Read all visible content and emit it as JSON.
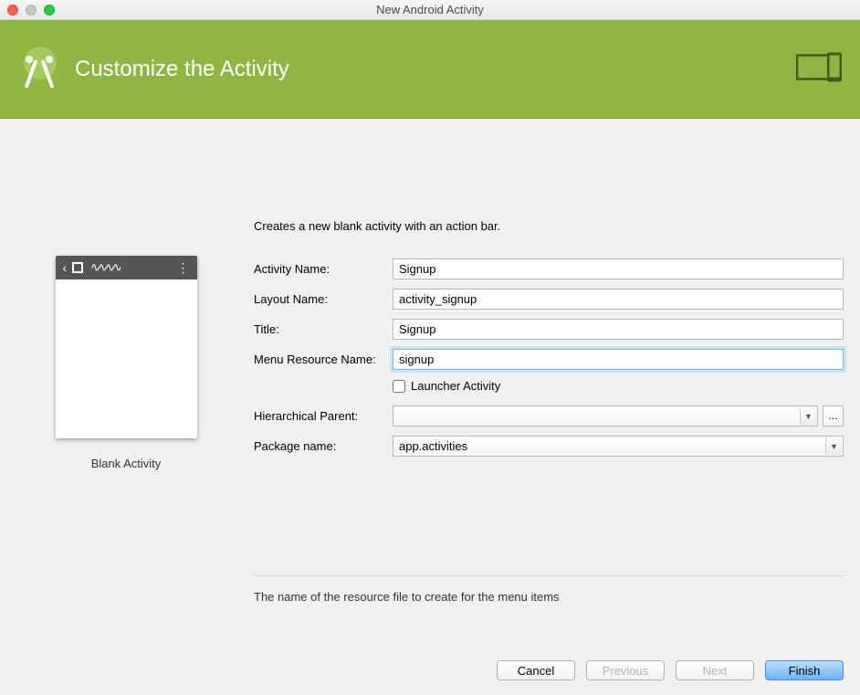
{
  "window": {
    "title": "New Android Activity"
  },
  "banner": {
    "title": "Customize the Activity"
  },
  "preview": {
    "caption": "Blank Activity"
  },
  "description": "Creates a new blank activity with an action bar.",
  "fields": {
    "activity_name": {
      "label": "Activity Name:",
      "value": "Signup"
    },
    "layout_name": {
      "label": "Layout Name:",
      "value": "activity_signup"
    },
    "title": {
      "label": "Title:",
      "value": "Signup"
    },
    "menu_resource": {
      "label": "Menu Resource Name:",
      "value": "signup"
    },
    "launcher": {
      "label": "Launcher Activity",
      "checked": false
    },
    "hierarchical": {
      "label": "Hierarchical Parent:",
      "value": ""
    },
    "package": {
      "label": "Package name:",
      "value": "app.activities"
    }
  },
  "hint": "The name of the resource file to create for the menu items",
  "buttons": {
    "cancel": "Cancel",
    "previous": "Previous",
    "next": "Next",
    "finish": "Finish"
  }
}
